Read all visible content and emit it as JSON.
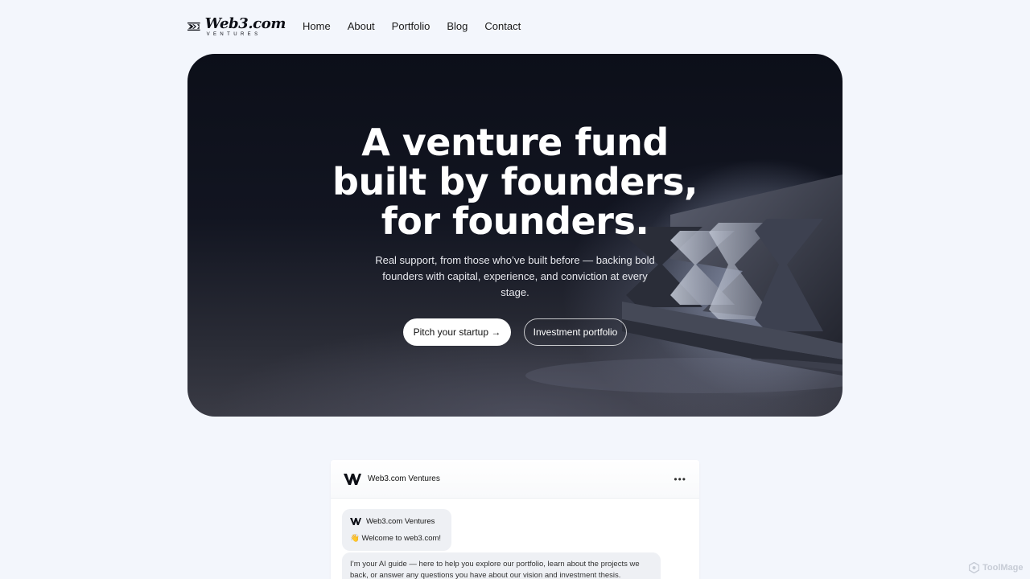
{
  "brand": {
    "name": "Web3.com",
    "tagline": "VENTURES"
  },
  "nav": {
    "items": [
      {
        "label": "Home"
      },
      {
        "label": "About"
      },
      {
        "label": "Portfolio"
      },
      {
        "label": "Blog"
      },
      {
        "label": "Contact"
      }
    ]
  },
  "hero": {
    "title": "A venture fund built by founders, for founders.",
    "subtitle": "Real support, from those who’ve built before — backing bold founders with capital, experience, and conviction at every stage.",
    "primary_cta": "Pitch your startup →",
    "secondary_cta": "Investment portfolio"
  },
  "chat": {
    "header_name": "Web3.com Ventures",
    "menu_icon": "more-horizontal-icon",
    "sender_name": "Web3.com Ventures",
    "greeting": "👋 Welcome to web3.com!",
    "intro": "I’m your AI guide — here to help you explore our portfolio, learn about the projects we back, or answer any questions you have about our vision and investment thesis."
  },
  "watermark": {
    "text": "ToolMage"
  }
}
